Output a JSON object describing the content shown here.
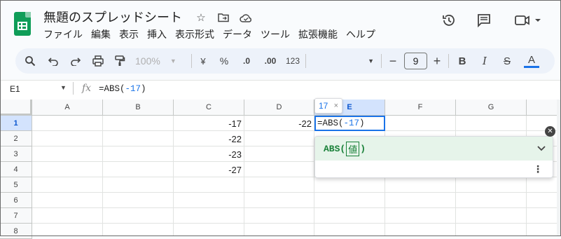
{
  "app": {
    "doc_title": "無題のスプレッドシート",
    "menu": [
      "ファイル",
      "編集",
      "表示",
      "挿入",
      "表示形式",
      "データ",
      "ツール",
      "拡張機能",
      "ヘルプ"
    ]
  },
  "toolbar": {
    "zoom": "100%",
    "currency": "¥",
    "percent": "%",
    "dec_decrease": ".0",
    "dec_increase": ".00",
    "number_format": "123",
    "font_size": "9",
    "bold": "B",
    "text_color_letter": "A",
    "text_color": "#1a73e8"
  },
  "formula_bar": {
    "cell_ref": "E1",
    "fx": "fx",
    "formula_prefix": "=ABS(",
    "formula_num": "-17",
    "formula_suffix": ")"
  },
  "grid": {
    "columns": [
      "A",
      "B",
      "C",
      "D",
      "E",
      "F",
      "G"
    ],
    "rows": [
      "1",
      "2",
      "3",
      "4",
      "5",
      "6",
      "7",
      "8"
    ],
    "cells": {
      "C1": "-17",
      "C2": "-22",
      "C3": "-23",
      "C4": "-27",
      "D1": "-22"
    },
    "selected_column": "E",
    "selected_row": "1"
  },
  "editor": {
    "preview_value": "17",
    "preview_close": "×",
    "edit_prefix": "=ABS(",
    "edit_num": "-17",
    "edit_suffix": ")"
  },
  "help_panel": {
    "fn_name": "ABS(",
    "arg": "値",
    "fn_close": ")"
  }
}
